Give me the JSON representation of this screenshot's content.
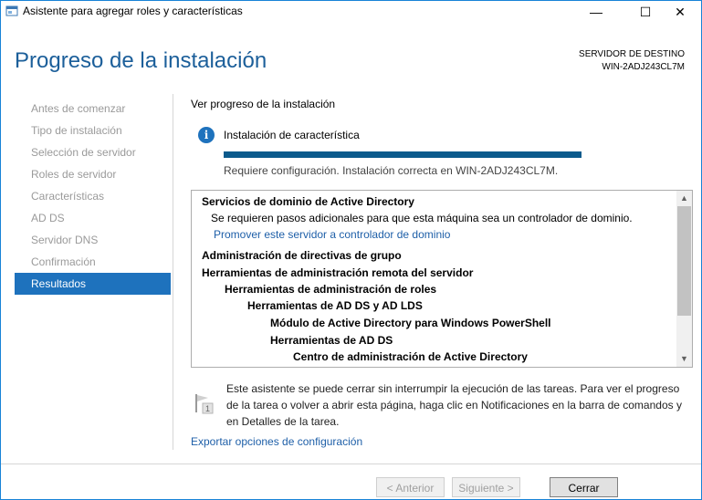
{
  "window": {
    "title": "Asistente para agregar roles y características",
    "minimize_symbol": "—",
    "maximize_symbol": "☐",
    "close_symbol": "✕"
  },
  "header": {
    "title": "Progreso de la instalación",
    "server_label": "SERVIDOR DE DESTINO",
    "server_name": "WIN-2ADJ243CL7M"
  },
  "nav": {
    "items": [
      {
        "label": "Antes de comenzar",
        "active": false
      },
      {
        "label": "Tipo de instalación",
        "active": false
      },
      {
        "label": "Selección de servidor",
        "active": false
      },
      {
        "label": "Roles de servidor",
        "active": false
      },
      {
        "label": "Características",
        "active": false
      },
      {
        "label": "AD DS",
        "active": false
      },
      {
        "label": "Servidor DNS",
        "active": false
      },
      {
        "label": "Confirmación",
        "active": false
      },
      {
        "label": "Resultados",
        "active": true
      }
    ]
  },
  "main": {
    "view_label": "Ver progreso de la instalación",
    "install_label": "Instalación de característica",
    "progress_fraction": 1.0,
    "install_status": "Requiere configuración. Instalación correcta en WIN-2ADJ243CL7M.",
    "results": [
      {
        "text": "Servicios de dominio de Active Directory",
        "style": "bold",
        "indent": 0
      },
      {
        "text": "Se requieren pasos adicionales para que esta máquina sea un controlador de dominio.",
        "style": "normal",
        "indent": 1
      },
      {
        "text": "Promover este servidor a controlador de dominio",
        "style": "link",
        "indent": 1
      },
      {
        "text": "Administración de directivas de grupo",
        "style": "bold",
        "indent": 0
      },
      {
        "text": "Herramientas de administración remota del servidor",
        "style": "bold",
        "indent": 0
      },
      {
        "text": "Herramientas de administración de roles",
        "style": "bold",
        "indent": 1
      },
      {
        "text": "Herramientas de AD DS y AD LDS",
        "style": "bold",
        "indent": 2
      },
      {
        "text": "Módulo de Active Directory para Windows PowerShell",
        "style": "bold",
        "indent": 3
      },
      {
        "text": "Herramientas de AD DS",
        "style": "bold",
        "indent": 3
      },
      {
        "text": "Centro de administración de Active Directory",
        "style": "bold",
        "indent": 4
      }
    ],
    "note": "Este asistente se puede cerrar sin interrumpir la ejecución de las tareas. Para ver el progreso de la tarea o volver a abrir esta página, haga clic en Notificaciones en la barra de comandos y en Detalles de la tarea.",
    "note_badge": "1",
    "export_link": "Exportar opciones de configuración"
  },
  "buttons": {
    "back": "< Anterior",
    "next": "Siguiente >",
    "close": "Cerrar"
  },
  "colors": {
    "accent": "#1e72bd",
    "progress": "#0b5a8c",
    "title": "#1c5f9a",
    "link": "#1e5fa8"
  },
  "icons": {
    "app": "wizard-icon",
    "info": "info-icon",
    "note": "flag-notification-icon"
  }
}
